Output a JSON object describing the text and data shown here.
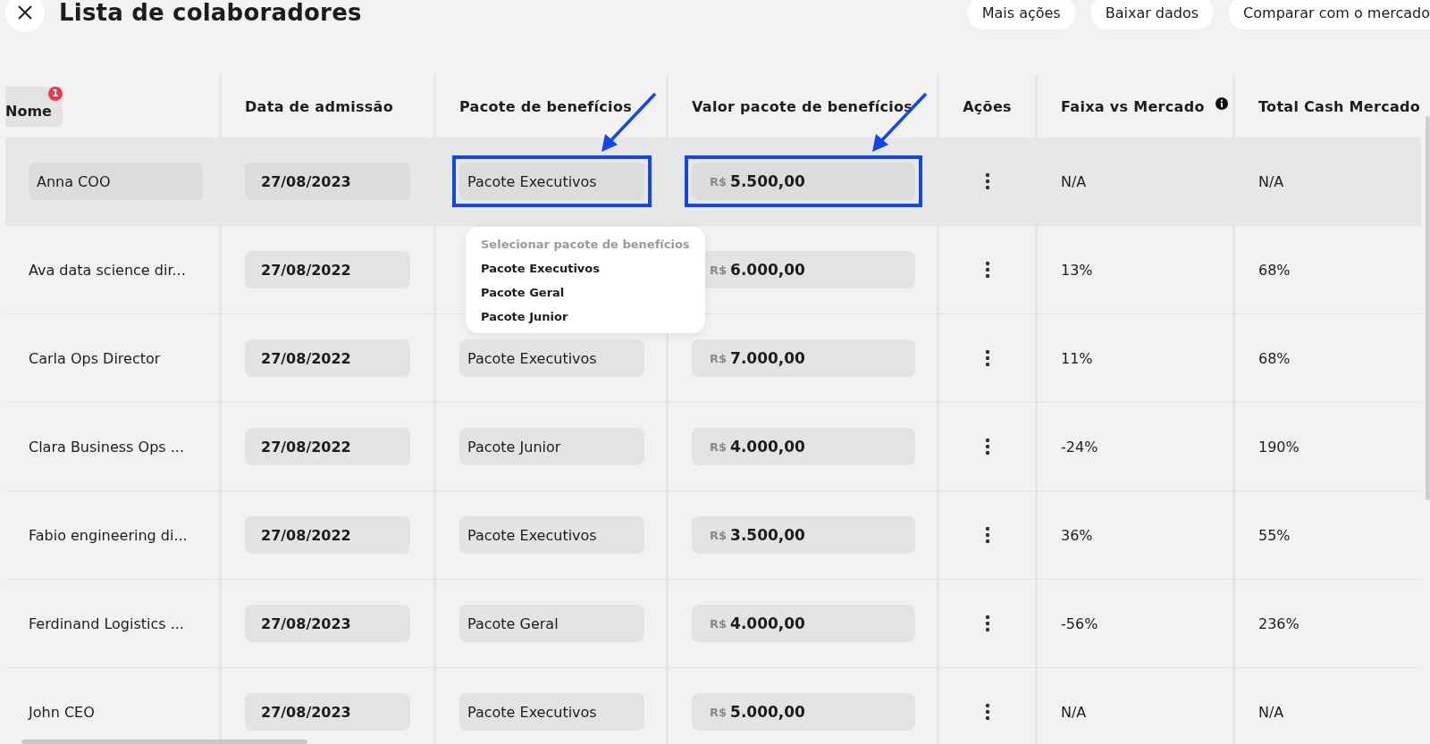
{
  "header": {
    "title": "Lista de colaboradores",
    "buttons": [
      "Mais ações",
      "Baixar dados",
      "Comparar com o mercado"
    ]
  },
  "table": {
    "columns": [
      {
        "label": "Nome",
        "badge": "1"
      },
      {
        "label": "Data de admissão"
      },
      {
        "label": "Pacote de benefícios"
      },
      {
        "label": "Valor pacote de benefícios"
      },
      {
        "label": "Ações"
      },
      {
        "label": "Faixa vs Mercado",
        "info": true
      },
      {
        "label": "Total Cash Mercado"
      }
    ],
    "rows": [
      {
        "selected": true,
        "name": "Anna COO",
        "date": "27/08/2023",
        "package": {
          "value": "Pacote Executivos",
          "highlighted": true
        },
        "amount": {
          "currency": "R$",
          "value": "5.500,00",
          "highlighted": true
        },
        "range": "N/A",
        "total": "N/A"
      },
      {
        "selected": false,
        "name": "Ava data science dir...",
        "date": "27/08/2022",
        "amount": {
          "currency": "R$",
          "value": "6.000,00",
          "highlighted": false
        },
        "range": "13%",
        "total": "68%"
      },
      {
        "selected": false,
        "name": "Carla Ops Director",
        "date": "27/08/2022",
        "package": {
          "value": "Pacote Executivos",
          "highlighted": false
        },
        "amount": {
          "currency": "R$",
          "value": "7.000,00",
          "highlighted": false
        },
        "range": "11%",
        "total": "68%"
      },
      {
        "selected": false,
        "name": "Clara Business Ops ...",
        "date": "27/08/2022",
        "package": {
          "value": "Pacote Junior",
          "highlighted": false
        },
        "amount": {
          "currency": "R$",
          "value": "4.000,00",
          "highlighted": false
        },
        "range": "-24%",
        "total": "190%"
      },
      {
        "selected": false,
        "name": "Fabio engineering di...",
        "date": "27/08/2022",
        "package": {
          "value": "Pacote Executivos",
          "highlighted": false
        },
        "amount": {
          "currency": "R$",
          "value": "3.500,00",
          "highlighted": false
        },
        "range": "36%",
        "total": "55%"
      },
      {
        "selected": false,
        "name": "Ferdinand Logistics ...",
        "date": "27/08/2023",
        "package": {
          "value": "Pacote Geral",
          "highlighted": false
        },
        "amount": {
          "currency": "R$",
          "value": "4.000,00",
          "highlighted": false
        },
        "range": "-56%",
        "total": "236%"
      },
      {
        "selected": false,
        "name": "John CEO",
        "date": "27/08/2023",
        "package": {
          "value": "Pacote Executivos",
          "highlighted": false
        },
        "amount": {
          "currency": "R$",
          "value": "5.000,00",
          "highlighted": false
        },
        "range": "N/A",
        "total": "N/A"
      }
    ]
  },
  "dropdown": {
    "placeholder": "Selecionar pacote de benefícios",
    "options": [
      "Pacote Executivos",
      "Pacote Geral",
      "Pacote Junior"
    ]
  }
}
